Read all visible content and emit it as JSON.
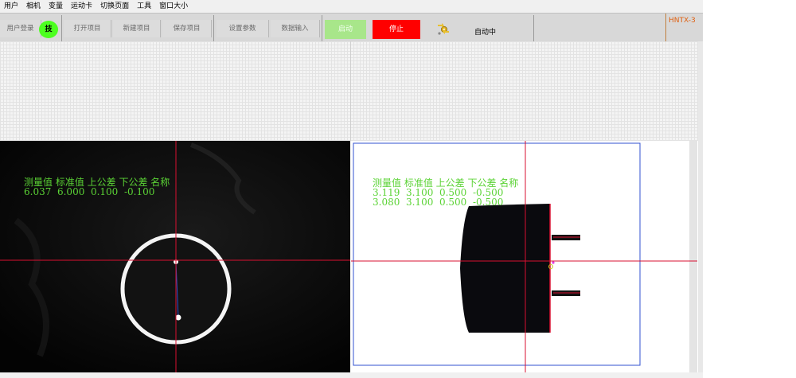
{
  "menu": [
    "用户",
    "相机",
    "变量",
    "运动卡",
    "切换页面",
    "工具",
    "窗口大小"
  ],
  "toolbar": {
    "login": "用户登录",
    "login_badge": "技",
    "open_project": "打开项目",
    "new_project": "新建项目",
    "save_project": "保存项目",
    "set_params": "设置参数",
    "data_input": "数据输入",
    "start": "启动",
    "stop": "停止",
    "status_icon": "gear-arrows-icon",
    "status": "自动中",
    "brand": "HNTX-3"
  },
  "left_view": {
    "header": "测量值 标准值 上公差 下公差 名称",
    "row1": "6.037  6.000  0.100  -0.100"
  },
  "right_view": {
    "header": "测量值 标准值 上公差 下公差 名称",
    "row1": "3.119  3.100  0.500  -0.500",
    "row2": "3.080  3.100  0.500  -0.500"
  },
  "colors": {
    "overlay_text": "#5bd335",
    "crosshair": "#d81030",
    "roi_box": "#3050d0",
    "start_bg": "#a8e68a",
    "stop_bg": "#ff0000",
    "badge_bg": "#4cff1f"
  }
}
